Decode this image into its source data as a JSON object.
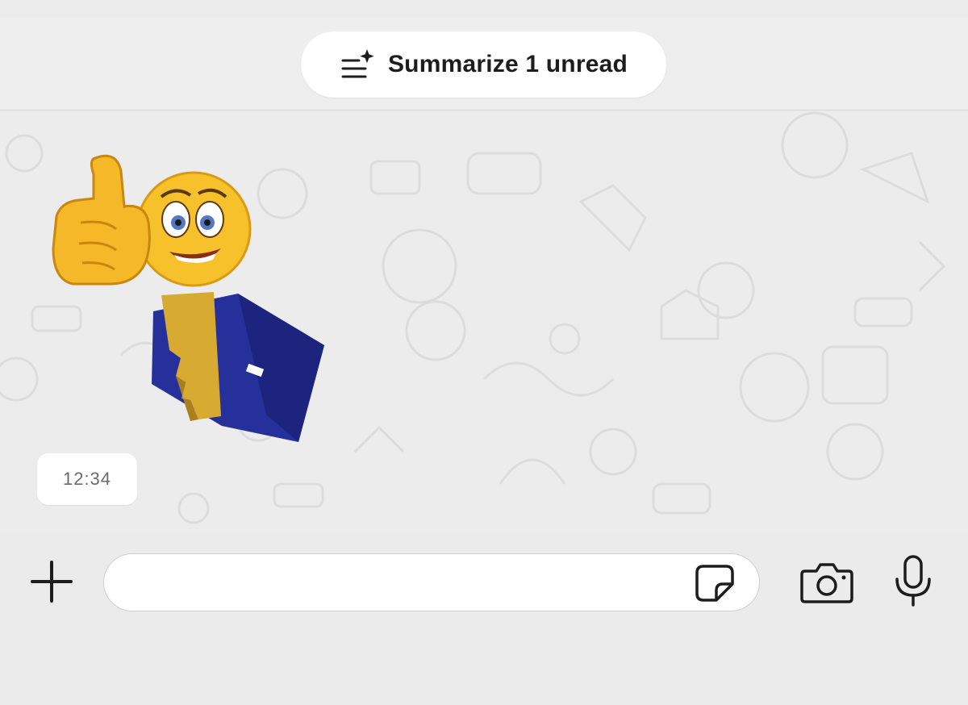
{
  "header": {
    "summarize_label": "Summarize 1 unread",
    "summarize_icon": "sparkle-list-icon"
  },
  "message": {
    "sticker": "thumbs-up-smiley-with-key-and-padlock",
    "time": "12:34"
  },
  "composer": {
    "attach_icon": "plus-icon",
    "message_value": "",
    "sticker_icon": "sticker-icon",
    "camera_icon": "camera-icon",
    "mic_icon": "microphone-icon"
  },
  "colors": {
    "chat_background": "#ececec",
    "bubble": "#ffffff",
    "icon": "#1d1d1d",
    "sticker_yellow": "#f6c12b",
    "sticker_blue": "#26309a",
    "sticker_key": "#d7aa32"
  }
}
